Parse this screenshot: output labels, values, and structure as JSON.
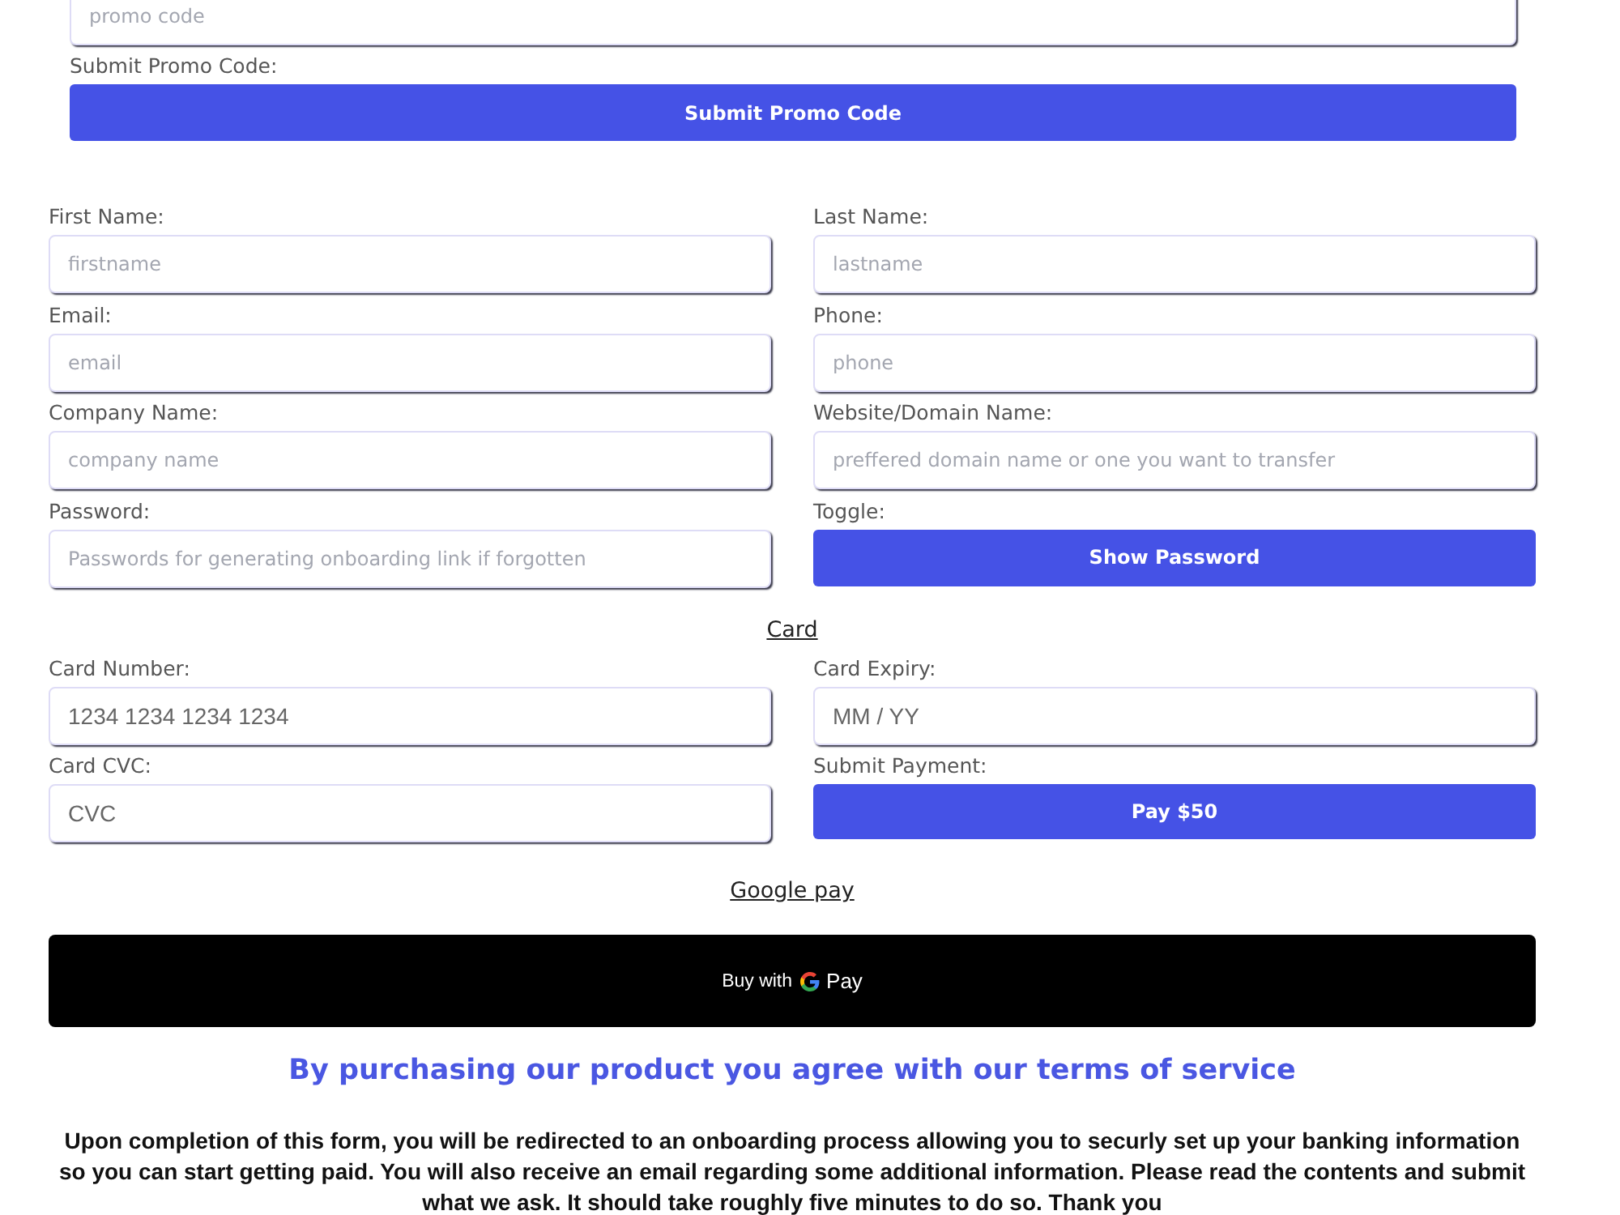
{
  "promo": {
    "placeholder": "promo code",
    "label": "Submit Promo Code:",
    "button": "Submit Promo Code"
  },
  "fields": [
    {
      "kind": "input",
      "label": "First Name:",
      "placeholder": "firstname"
    },
    {
      "kind": "input",
      "label": "Last Name:",
      "placeholder": "lastname"
    },
    {
      "kind": "input",
      "label": "Email:",
      "placeholder": "email"
    },
    {
      "kind": "input",
      "label": "Phone:",
      "placeholder": "phone"
    },
    {
      "kind": "input",
      "label": "Company Name:",
      "placeholder": "company name"
    },
    {
      "kind": "input",
      "label": "Website/Domain Name:",
      "placeholder": "preffered domain name or one you want to transfer"
    },
    {
      "kind": "input",
      "label": "Password:",
      "placeholder": "Passwords for generating onboarding link if forgotten"
    },
    {
      "kind": "button",
      "label": "Toggle:",
      "text": "Show Password"
    }
  ],
  "card_link": "Card",
  "card_fields": [
    {
      "kind": "card_input",
      "label": "Card Number:",
      "placeholder": "1234 1234 1234 1234"
    },
    {
      "kind": "card_input",
      "label": "Card Expiry:",
      "placeholder": "MM / YY"
    },
    {
      "kind": "card_input",
      "label": "Card CVC:",
      "placeholder": "CVC"
    },
    {
      "kind": "button",
      "label": "Submit Payment:",
      "text": "Pay $50"
    }
  ],
  "gpay_link": "Google pay",
  "gpay_button": {
    "prefix": "Buy with",
    "suffix": "Pay"
  },
  "terms": "By purchasing our product you agree with our terms of service",
  "notice": "Upon completion of this form, you will be redirected to an onboarding process allowing you to securly set up your banking information so you can start getting paid. You will also receive an email regarding some additional information. Please read the contents and submit what we ask. It should take roughly five minutes to do so. Thank you"
}
